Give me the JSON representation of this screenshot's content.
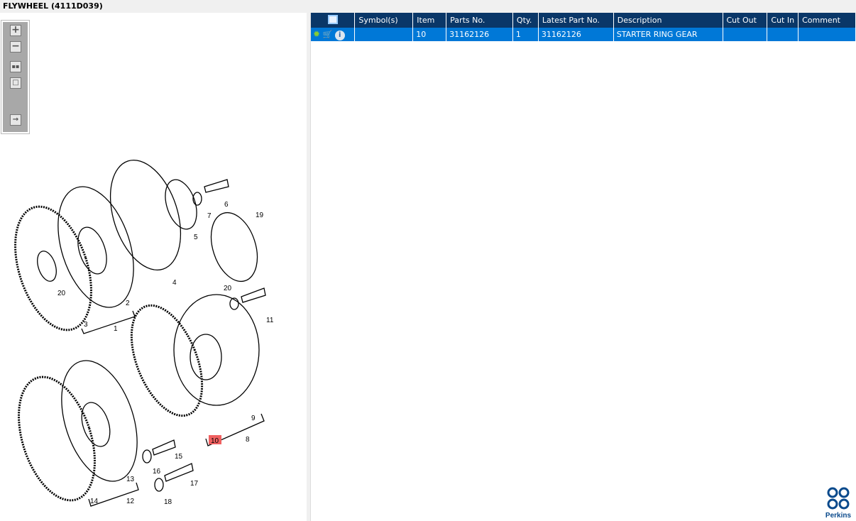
{
  "title": "FLYWHEEL (4111D039)",
  "toolbar": {
    "zoom_in": "+",
    "zoom_out": "−",
    "fit": "fit-all",
    "actual": "actual-size",
    "export": "export"
  },
  "table": {
    "headers": [
      "Symbol(s)",
      "Item",
      "Parts No.",
      "Qty.",
      "Latest Part No.",
      "Description",
      "Cut Out",
      "Cut In",
      "Comment"
    ],
    "rows": [
      {
        "symbols": "",
        "item": "10",
        "parts_no": "31162126",
        "qty": "1",
        "latest": "31162126",
        "description": "STARTER RING GEAR",
        "cut_out": "",
        "cut_in": "",
        "comment": ""
      }
    ]
  },
  "callouts": [
    "6",
    "7",
    "5",
    "19",
    "4",
    "20",
    "2",
    "3",
    "1",
    "20",
    "11",
    "9",
    "10",
    "8",
    "16",
    "15",
    "13",
    "17",
    "14",
    "12",
    "18"
  ],
  "highlight_color": "#f06060",
  "brand": "Perkins"
}
